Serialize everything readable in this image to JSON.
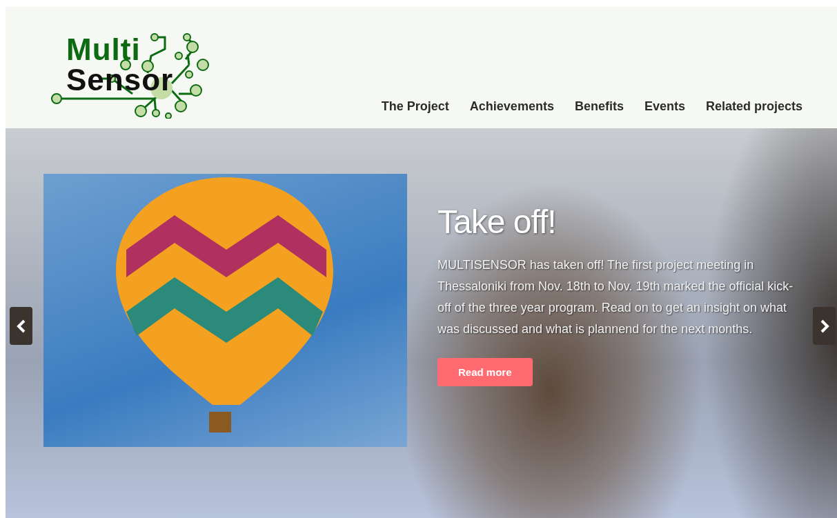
{
  "logo": {
    "line_1": "Multi",
    "line_2": "Sensor"
  },
  "nav": [
    {
      "label": "The Project"
    },
    {
      "label": "Achievements"
    },
    {
      "label": "Benefits"
    },
    {
      "label": "Events"
    },
    {
      "label": "Related projects"
    }
  ],
  "slide": {
    "title": "Take off!",
    "text": "MULTISENSOR has taken off! The first project meeting in Thessaloniki from Nov. 18th to Nov. 19th marked the official kick-off of the three year program. Read on to get an insight on what was discussed and what is plannend for the next months.",
    "button": "Read more"
  }
}
